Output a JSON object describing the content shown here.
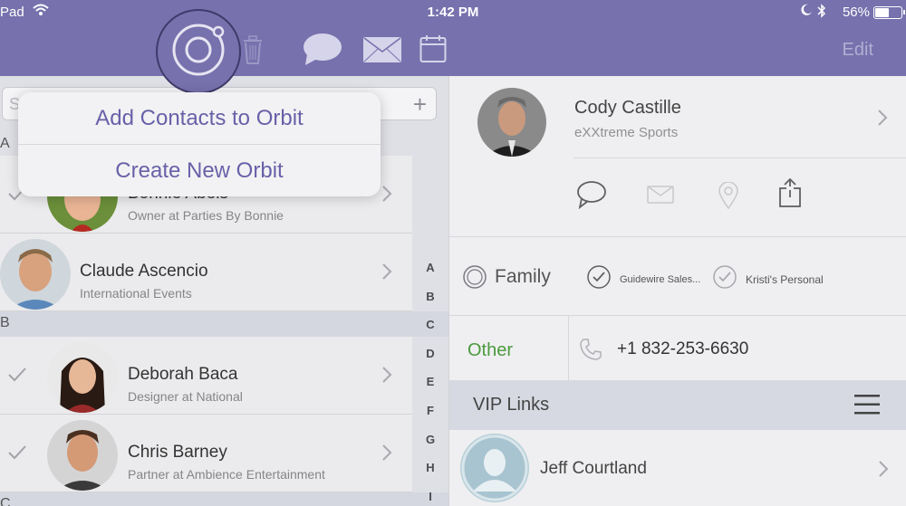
{
  "status_bar": {
    "carrier": "Pad",
    "time": "1:42 PM",
    "battery_percent": "56%",
    "battery_level": 0.56
  },
  "toolbar": {
    "edit_label": "Edit",
    "icons": [
      "orbit-icon",
      "trash-icon",
      "chat-bubble-icon",
      "envelope-icon",
      "calendar-icon"
    ]
  },
  "search": {
    "placeholder": "S",
    "add_icon": "+"
  },
  "popup": {
    "items": [
      "Add Contacts to Orbit",
      "Create New Orbit"
    ]
  },
  "contacts": {
    "sections": [
      {
        "letter": "A"
      },
      {
        "letter": "B"
      },
      {
        "letter": "C"
      }
    ],
    "rows": [
      {
        "name": "Bonnie Abels",
        "subtitle": "Owner at Parties By Bonnie",
        "checked": true
      },
      {
        "name": "Claude Ascencio",
        "subtitle": "International Events",
        "checked": false
      },
      {
        "name": "Deborah Baca",
        "subtitle": "Designer at National",
        "checked": true
      },
      {
        "name": "Chris Barney",
        "subtitle": "Partner at Ambience Entertainment",
        "checked": true
      }
    ],
    "index_letters": [
      "A",
      "B",
      "C",
      "D",
      "E",
      "F",
      "G",
      "H",
      "I"
    ]
  },
  "detail": {
    "name": "Cody Castille",
    "company": "eXXtreme Sports",
    "tags": [
      "Family",
      "Guidewire Sales...",
      "Kristi's Personal"
    ],
    "phone_label": "Other",
    "phone_number": "+1 832-253-6630",
    "vip_title": "VIP Links",
    "vip_contact": "Jeff Courtland"
  },
  "colors": {
    "header": "#7771ad",
    "popup_text": "#6861a8",
    "phone_label": "#4a9a3d"
  }
}
